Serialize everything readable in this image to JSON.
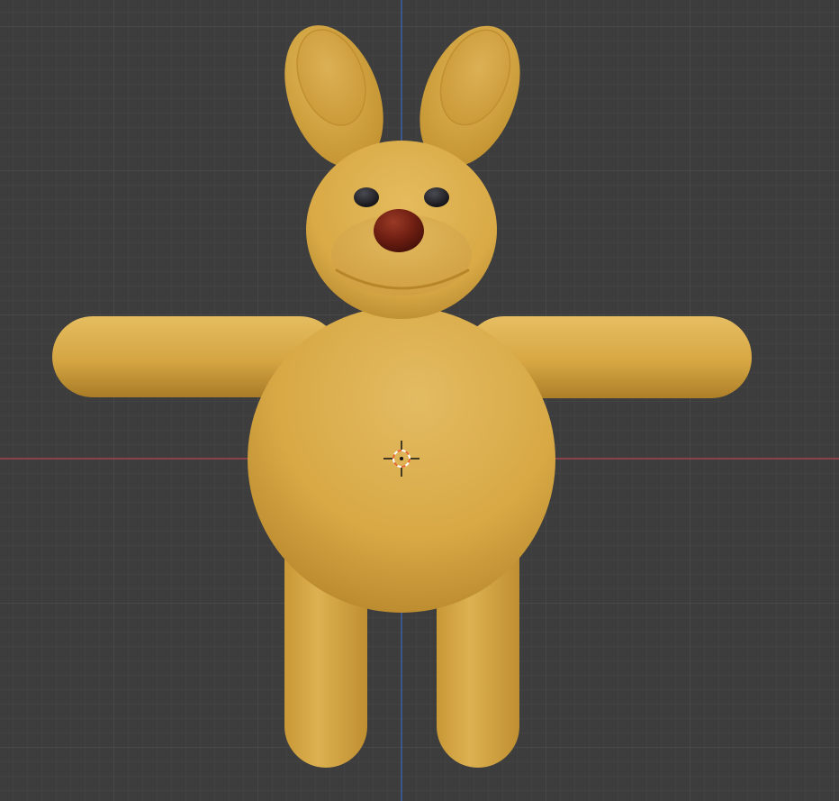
{
  "viewport": {
    "background_color": "#3d3d3d",
    "grid_minor_color": "#474747",
    "grid_major_color": "#505050",
    "x_axis_color": "#a3434e",
    "z_axis_color": "#3b5fa3"
  },
  "model": {
    "body_color": "#dcac48",
    "body_shadow_color": "#b88a2e",
    "body_highlight_color": "#e8c066",
    "nose_color": "#6e1e12",
    "eye_color": "#1e1e22"
  },
  "cursor": {
    "icon": "3d-cursor-icon",
    "ring_color_a": "#e8662a",
    "ring_color_b": "#ffffff",
    "crosshair_color": "#111111"
  }
}
